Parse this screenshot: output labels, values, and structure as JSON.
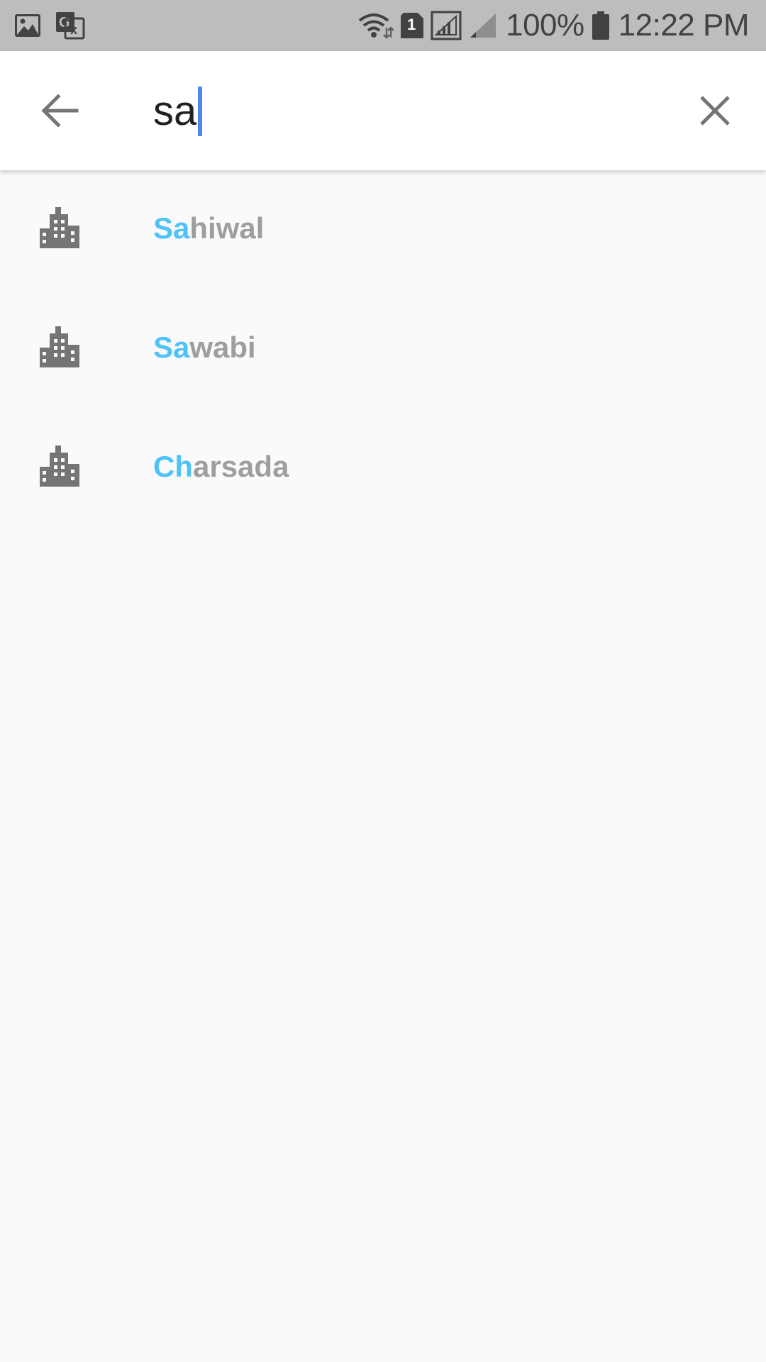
{
  "status_bar": {
    "left_icons": [
      "image-icon",
      "translate-icon"
    ],
    "battery_text": "100%",
    "time": "12:22 PM",
    "sim_badge": "1"
  },
  "search": {
    "query": "sa",
    "back_icon": "arrow-left-icon",
    "clear_icon": "close-icon"
  },
  "colors": {
    "highlight": "#4fc3f7",
    "text_rest": "#9e9e9e",
    "icon": "#757575",
    "caret": "#4f86ec"
  },
  "suggestions": [
    {
      "icon": "city-icon",
      "match": "Sa",
      "rest": "hiwal"
    },
    {
      "icon": "city-icon",
      "match": "Sa",
      "rest": "wabi"
    },
    {
      "icon": "city-icon",
      "match": "Ch",
      "rest": "arsada"
    }
  ]
}
